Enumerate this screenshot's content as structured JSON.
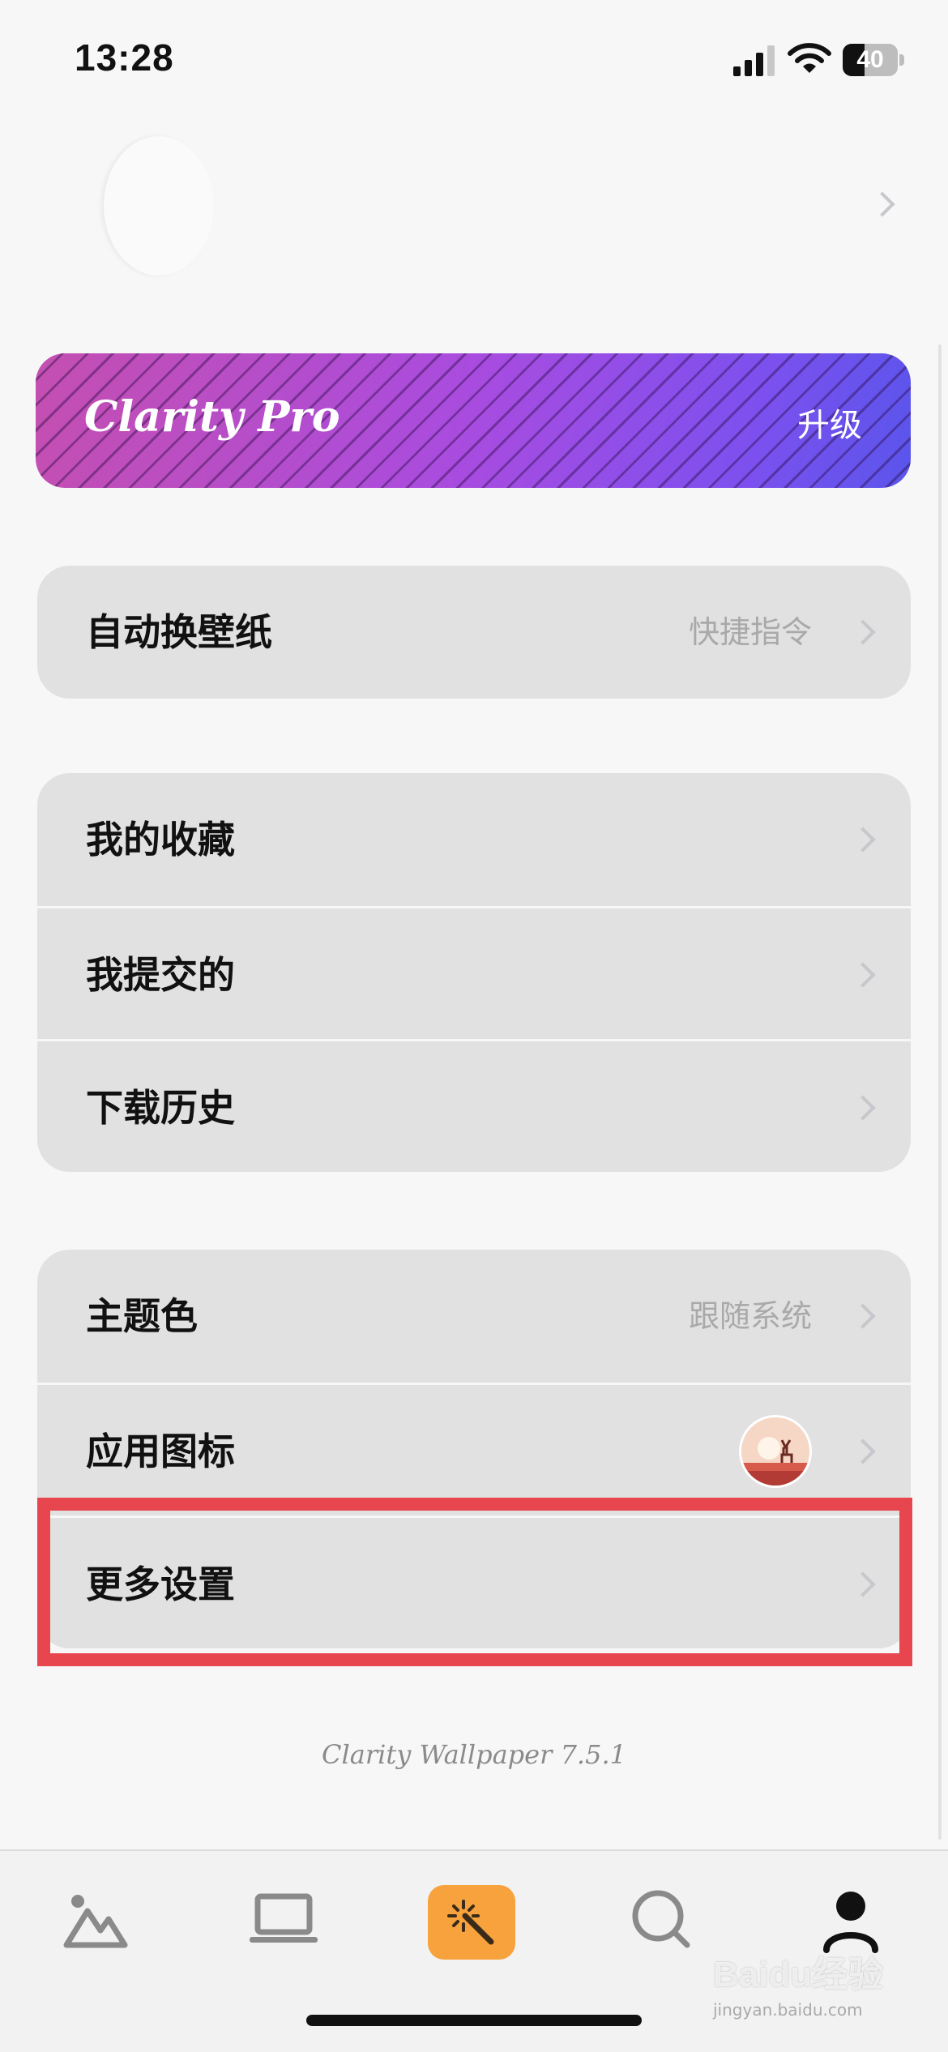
{
  "status_bar": {
    "time": "13:28",
    "battery_level": "40",
    "battery_fraction": 0.4
  },
  "profile": {
    "avatar_icon": "avatar-placeholder"
  },
  "pro_banner": {
    "title": "Clarity Pro",
    "upgrade_label": "升级",
    "colors": [
      "#c54fb1",
      "#a84ce0",
      "#5a55ec"
    ]
  },
  "settings": {
    "auto_wallpaper": {
      "label": "自动换壁纸",
      "detail": "快捷指令"
    },
    "library": {
      "favorites": "我的收藏",
      "submitted": "我提交的",
      "download_history": "下载历史"
    },
    "appearance": {
      "theme_color": {
        "label": "主题色",
        "detail": "跟随系统"
      },
      "app_icon": {
        "label": "应用图标",
        "icon": "deer-sunset-icon"
      },
      "more_settings": {
        "label": "更多设置"
      }
    }
  },
  "highlight_color": "#e8464e",
  "version": "Clarity Wallpaper 7.5.1",
  "tab_bar": {
    "tabs": [
      {
        "icon": "mountain-photo-icon"
      },
      {
        "icon": "laptop-icon"
      },
      {
        "icon": "magic-wand-icon",
        "active": true,
        "color": "#f7a23c"
      },
      {
        "icon": "search-icon"
      },
      {
        "icon": "person-icon"
      }
    ]
  },
  "watermark": {
    "main": "Baidu经验",
    "sub": "jingyan.baidu.com"
  }
}
